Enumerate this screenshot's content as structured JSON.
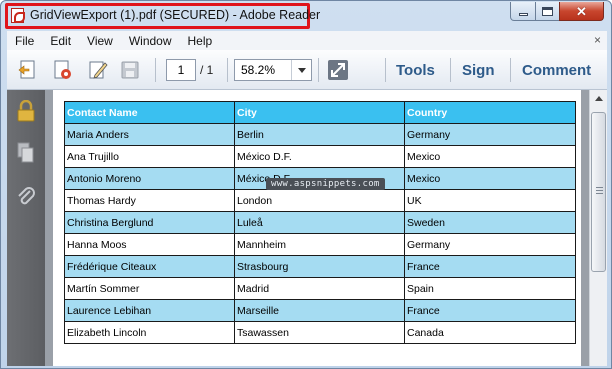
{
  "window": {
    "title": "GridViewExport (1).pdf (SECURED) - Adobe Reader",
    "icon": "pdf-file-icon"
  },
  "menu": {
    "items": [
      "File",
      "Edit",
      "View",
      "Window",
      "Help"
    ],
    "close_glyph": "×"
  },
  "toolbar": {
    "current_page": "1",
    "page_total": "/ 1",
    "zoom": "58.2%",
    "links": {
      "tools": "Tools",
      "sign": "Sign",
      "comment": "Comment"
    },
    "icons": [
      "create-pdf-icon",
      "pdf-settings-icon",
      "edit-icon",
      "save-disk-icon",
      "fullscreen-expand-icon"
    ]
  },
  "navpane": {
    "icons": [
      "lock-icon",
      "pages-icon",
      "attachment-icon"
    ]
  },
  "document": {
    "watermark": "www.aspsnippets.com",
    "table": {
      "headers": [
        "Contact Name",
        "City",
        "Country"
      ],
      "rows": [
        [
          "Maria Anders",
          "Berlin",
          "Germany"
        ],
        [
          "Ana Trujillo",
          "México D.F.",
          "Mexico"
        ],
        [
          "Antonio Moreno",
          "México D.F.",
          "Mexico"
        ],
        [
          "Thomas Hardy",
          "London",
          "UK"
        ],
        [
          "Christina Berglund",
          "Luleå",
          "Sweden"
        ],
        [
          "Hanna Moos",
          "Mannheim",
          "Germany"
        ],
        [
          "Frédérique Citeaux",
          "Strasbourg",
          "France"
        ],
        [
          "Martín Sommer",
          "Madrid",
          "Spain"
        ],
        [
          "Laurence Lebihan",
          "Marseille",
          "France"
        ],
        [
          "Elizabeth Lincoln",
          "Tsawassen",
          "Canada"
        ]
      ]
    }
  },
  "colors": {
    "header_bg": "#3ac0f0",
    "alt_row_bg": "#a5dcf2",
    "highlight_border": "#e0141b",
    "link_blue": "#2e5b8a"
  }
}
